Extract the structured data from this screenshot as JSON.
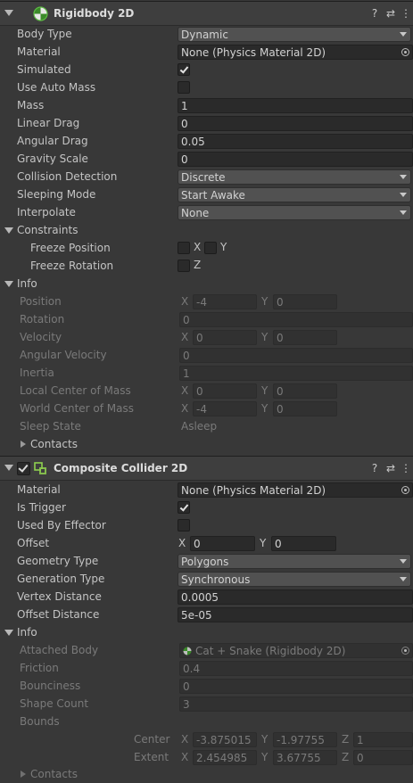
{
  "rigidbody": {
    "title": "Rigidbody 2D",
    "icon": "rigidbody2d-icon",
    "icon_color": "#5dbb43",
    "body_type_label": "Body Type",
    "body_type": "Dynamic",
    "material_label": "Material",
    "material": "None (Physics Material 2D)",
    "simulated_label": "Simulated",
    "simulated": true,
    "use_auto_mass_label": "Use Auto Mass",
    "use_auto_mass": false,
    "mass_label": "Mass",
    "mass": "1",
    "linear_drag_label": "Linear Drag",
    "linear_drag": "0",
    "angular_drag_label": "Angular Drag",
    "angular_drag": "0.05",
    "gravity_scale_label": "Gravity Scale",
    "gravity_scale": "0",
    "collision_detection_label": "Collision Detection",
    "collision_detection": "Discrete",
    "sleeping_mode_label": "Sleeping Mode",
    "sleeping_mode": "Start Awake",
    "interpolate_label": "Interpolate",
    "interpolate": "None",
    "constraints_label": "Constraints",
    "freeze_position_label": "Freeze Position",
    "freeze_position_x": "X",
    "freeze_position_y": "Y",
    "freeze_rotation_label": "Freeze Rotation",
    "freeze_rotation_z": "Z",
    "info": {
      "label": "Info",
      "position_label": "Position",
      "position_x": "-4",
      "position_y": "0",
      "rotation_label": "Rotation",
      "rotation": "0",
      "velocity_label": "Velocity",
      "velocity_x": "0",
      "velocity_y": "0",
      "angular_velocity_label": "Angular Velocity",
      "angular_velocity": "0",
      "inertia_label": "Inertia",
      "inertia": "1",
      "local_com_label": "Local Center of Mass",
      "local_com_x": "0",
      "local_com_y": "0",
      "world_com_label": "World Center of Mass",
      "world_com_x": "-4",
      "world_com_y": "0",
      "sleep_state_label": "Sleep State",
      "sleep_state": "Asleep",
      "contacts_label": "Contacts"
    }
  },
  "composite": {
    "title": "Composite Collider 2D",
    "icon": "composite-collider-icon",
    "icon_color": "#8fd14f",
    "material_label": "Material",
    "material": "None (Physics Material 2D)",
    "is_trigger_label": "Is Trigger",
    "is_trigger": true,
    "used_by_effector_label": "Used By Effector",
    "used_by_effector": false,
    "offset_label": "Offset",
    "offset_x": "0",
    "offset_y": "0",
    "geometry_type_label": "Geometry Type",
    "geometry_type": "Polygons",
    "generation_type_label": "Generation Type",
    "generation_type": "Synchronous",
    "vertex_distance_label": "Vertex Distance",
    "vertex_distance": "0.0005",
    "offset_distance_label": "Offset Distance",
    "offset_distance": "5e-05",
    "info": {
      "label": "Info",
      "attached_body_label": "Attached Body",
      "attached_body": "Cat + Snake (Rigidbody 2D)",
      "friction_label": "Friction",
      "friction": "0.4",
      "bounciness_label": "Bounciness",
      "bounciness": "0",
      "shape_count_label": "Shape Count",
      "shape_count": "3",
      "bounds_label": "Bounds",
      "center_label": "Center",
      "center_x": "-3.875015",
      "center_y": "-1.97755",
      "center_z": "1",
      "extent_label": "Extent",
      "extent_x": "2.454985",
      "extent_y": "3.67755",
      "extent_z": "0",
      "contacts_label": "Contacts"
    }
  },
  "axis": {
    "x": "X",
    "y": "Y",
    "z": "Z"
  },
  "header_buttons": {
    "help": "?",
    "presets": "⇄",
    "menu": "⋮"
  }
}
